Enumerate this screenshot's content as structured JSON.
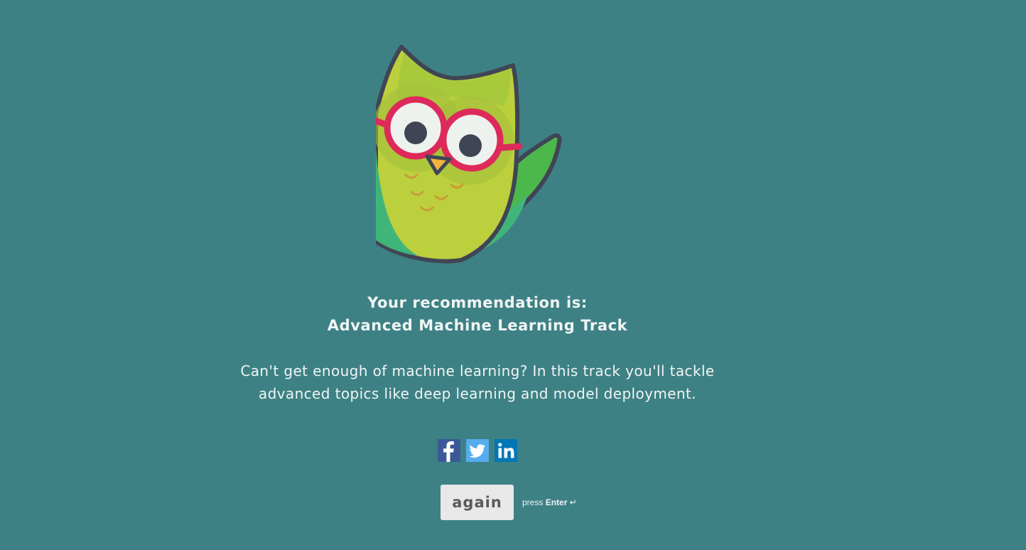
{
  "result": {
    "heading_line1": "Your recommendation is:",
    "heading_line2": "Advanced Machine Learning Track",
    "description_line1": "Can't get enough of machine learning? In this track you'll tackle",
    "description_line2": "advanced topics like deep learning and model deployment."
  },
  "share": {
    "facebook_icon": "facebook-icon",
    "twitter_icon": "twitter-icon",
    "linkedin_icon": "linkedin-icon",
    "facebook_color": "#3b5998",
    "twitter_color": "#55acee",
    "linkedin_color": "#0077b5"
  },
  "actions": {
    "again_label": "again",
    "hint_prefix": "press",
    "hint_key": "Enter",
    "hint_symbol": "↵"
  },
  "colors": {
    "background": "#3d8185",
    "button_background": "#e8e8e8",
    "owl_body": "#b9cd3e",
    "glasses": "#dd2a5b"
  }
}
